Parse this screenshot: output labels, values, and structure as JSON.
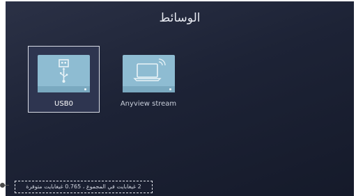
{
  "screen": {
    "title": "الوسائط",
    "sources": [
      {
        "label": "USB0",
        "icon": "usb-drive-icon",
        "selected": true
      },
      {
        "label": "Anyview stream",
        "icon": "laptop-cast-icon",
        "selected": false
      }
    ],
    "storage_info": "2 غيغابايت في المجموع ، 0.765 غيغابايت متوفرة"
  },
  "colors": {
    "background": "#1d2336",
    "tile_icon": "#8ebcd2",
    "selection_border": "#d9dde6"
  }
}
